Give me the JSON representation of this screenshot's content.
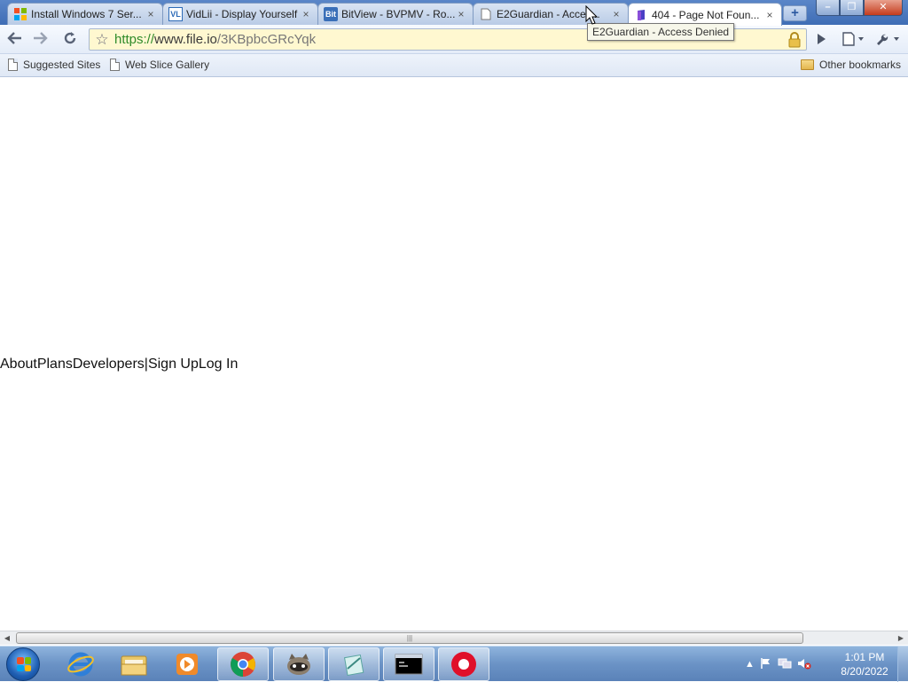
{
  "tabs": [
    {
      "title": "Install Windows 7 Ser...",
      "icon": "windows-logo-icon",
      "close": "×"
    },
    {
      "title": "VidLii - Display Yourself",
      "icon": "vidlii-logo-icon",
      "icon_text": "VL",
      "close": "×"
    },
    {
      "title": "BitView - BVPMV - Ro...",
      "icon": "bitview-logo-icon",
      "icon_text": "Bit",
      "close": "×"
    },
    {
      "title": "E2Guardian - Acces...",
      "icon": "page-icon",
      "close": "×"
    },
    {
      "title": "404 - Page Not Foun...",
      "icon": "file-io-logo-icon",
      "close": "×"
    }
  ],
  "new_tab": "+",
  "window_buttons": {
    "minimize": "–",
    "restore": "❐",
    "close": "✕"
  },
  "toolbar": {
    "url_scheme": "https://",
    "url_host": "www.file.io",
    "url_path": "/3KBpbcGRcYqk"
  },
  "bookmarks": {
    "items": [
      "Suggested Sites",
      "Web Slice Gallery"
    ],
    "other": "Other bookmarks"
  },
  "tooltip": "E2Guardian - Access Denied",
  "page": {
    "nav": [
      "About",
      "Plans",
      "Developers",
      "|",
      "Sign Up",
      "Log In"
    ]
  },
  "scrollbar": {
    "grip": "|||"
  },
  "taskbar": {
    "clock_time": "1:01 PM",
    "clock_date": "8/20/2022",
    "apps": [
      "internet-explorer",
      "windows-explorer",
      "media-player",
      "chrome",
      "raccoon-app",
      "notepad",
      "command-prompt",
      "record-app"
    ]
  },
  "colors": {
    "taskbar": "#6b93c6",
    "omnibox": "#fff8d0",
    "url_scheme": "#2f8b2a"
  }
}
